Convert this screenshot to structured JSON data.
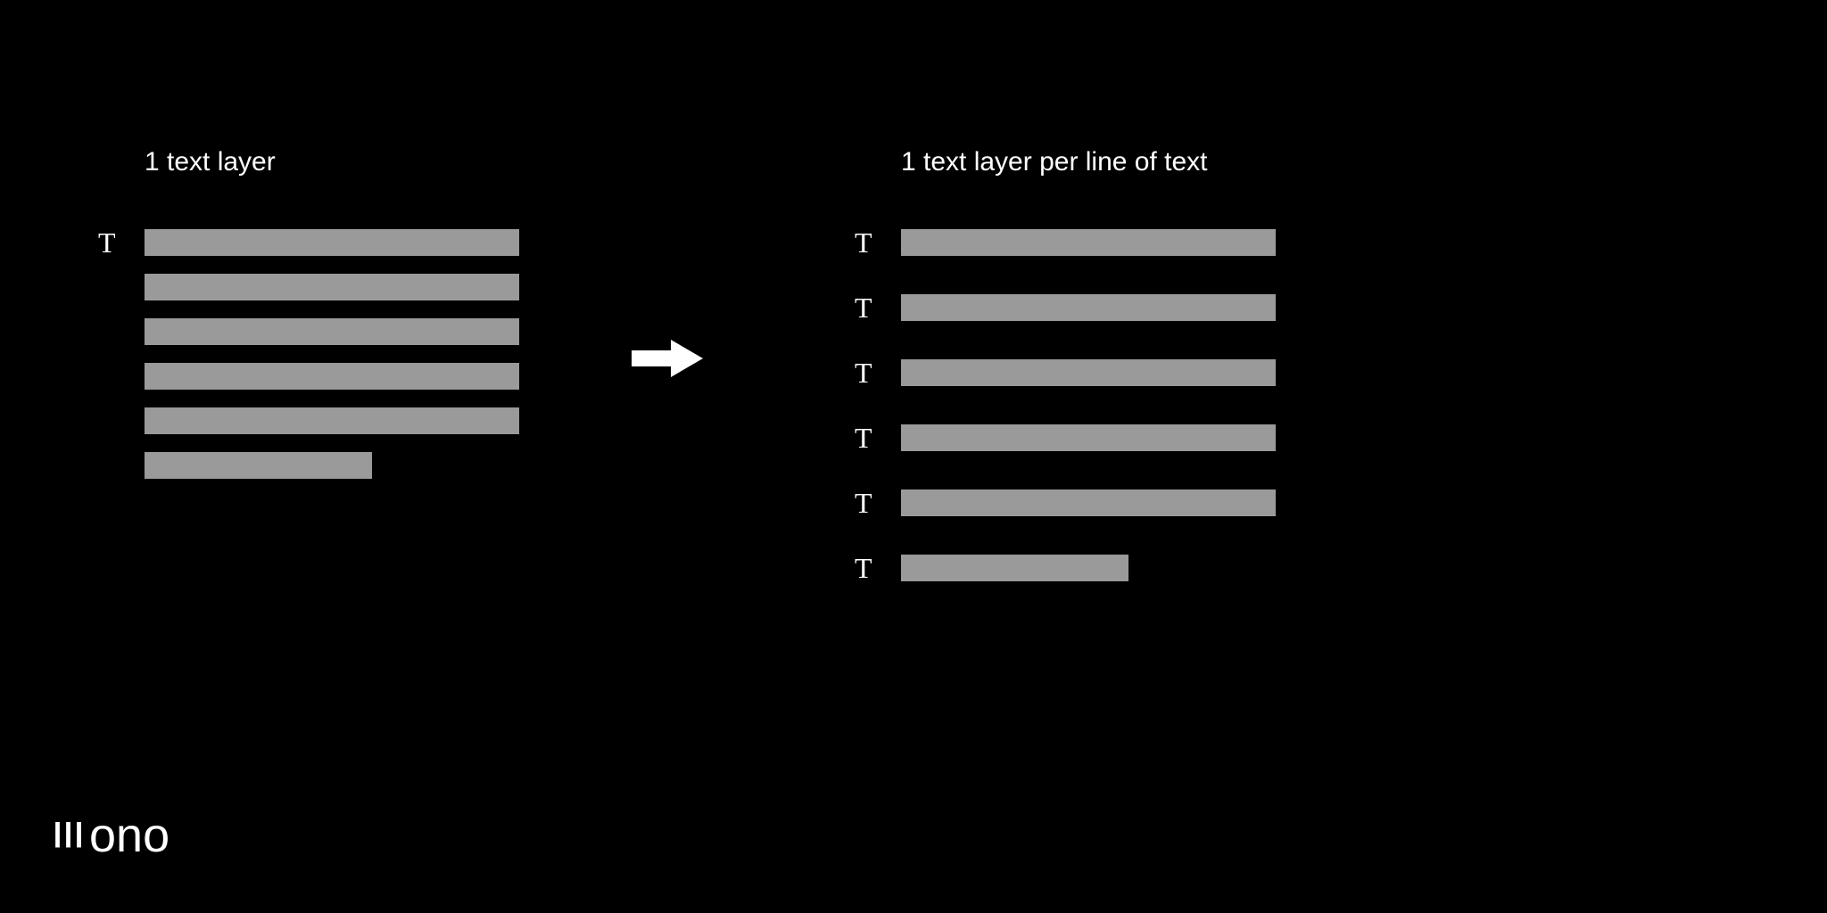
{
  "left": {
    "title": "1 text layer",
    "icon_label": "T",
    "rows": [
      {
        "has_icon": true,
        "width": "full"
      },
      {
        "has_icon": false,
        "width": "full"
      },
      {
        "has_icon": false,
        "width": "full"
      },
      {
        "has_icon": false,
        "width": "full"
      },
      {
        "has_icon": false,
        "width": "full"
      },
      {
        "has_icon": false,
        "width": "short"
      }
    ]
  },
  "right": {
    "title": "1 text layer per line of text",
    "icon_label": "T",
    "rows": [
      {
        "has_icon": true,
        "width": "full"
      },
      {
        "has_icon": true,
        "width": "full"
      },
      {
        "has_icon": true,
        "width": "full"
      },
      {
        "has_icon": true,
        "width": "full"
      },
      {
        "has_icon": true,
        "width": "full"
      },
      {
        "has_icon": true,
        "width": "short"
      }
    ]
  },
  "logo": {
    "prefix_glyph": "ııı",
    "text": "ono"
  }
}
